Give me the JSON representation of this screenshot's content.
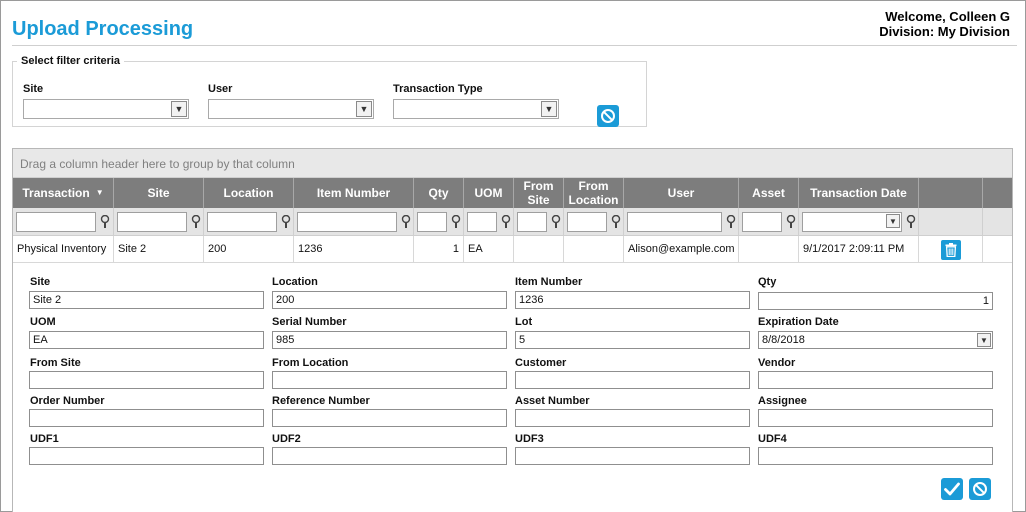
{
  "header": {
    "title": "Upload Processing",
    "welcome": "Welcome, Colleen G",
    "division": "Division: My Division"
  },
  "filter": {
    "legend": "Select filter criteria",
    "site_label": "Site",
    "user_label": "User",
    "transaction_type_label": "Transaction Type"
  },
  "grid": {
    "group_hint": "Drag a column header here to group by that column",
    "columns": [
      "Transaction",
      "Site",
      "Location",
      "Item Number",
      "Qty",
      "UOM",
      "From Site",
      "From Location",
      "User",
      "Asset",
      "Transaction Date"
    ],
    "row": {
      "transaction": "Physical Inventory",
      "site": "Site 2",
      "location": "200",
      "item_number": "1236",
      "qty": "1",
      "uom": "EA",
      "from_site": "",
      "from_location": "",
      "user": "Alison@example.com",
      "asset": "",
      "transaction_date": "9/1/2017 2:09:11 PM"
    }
  },
  "detail": {
    "fields": [
      {
        "label": "Site",
        "value": "Site 2"
      },
      {
        "label": "Location",
        "value": "200"
      },
      {
        "label": "Item Number",
        "value": "1236"
      },
      {
        "label": "Qty",
        "value": "1"
      },
      {
        "label": "UOM",
        "value": "EA"
      },
      {
        "label": "Serial Number",
        "value": "985"
      },
      {
        "label": "Lot",
        "value": "5"
      },
      {
        "label": "Expiration Date",
        "value": "8/8/2018"
      },
      {
        "label": "From Site",
        "value": ""
      },
      {
        "label": "From Location",
        "value": ""
      },
      {
        "label": "Customer",
        "value": ""
      },
      {
        "label": "Vendor",
        "value": ""
      },
      {
        "label": "Order Number",
        "value": ""
      },
      {
        "label": "Reference Number",
        "value": ""
      },
      {
        "label": "Asset Number",
        "value": ""
      },
      {
        "label": "Assignee",
        "value": ""
      },
      {
        "label": "UDF1",
        "value": ""
      },
      {
        "label": "UDF2",
        "value": ""
      },
      {
        "label": "UDF3",
        "value": ""
      },
      {
        "label": "UDF4",
        "value": ""
      }
    ]
  },
  "icons": {
    "clear": "ban-icon",
    "filter": "filter-funnel-icon",
    "delete": "trash-icon",
    "save": "checkmark-icon",
    "cancel": "ban-icon",
    "dropdown": "chevron-down-icon",
    "sort": "sort-down-icon"
  },
  "colors": {
    "accent": "#1b9bd7",
    "header_bg": "#7d7d7d",
    "filter_row_bg": "#e4e4e4",
    "group_panel_bg": "#e8e8e8"
  }
}
